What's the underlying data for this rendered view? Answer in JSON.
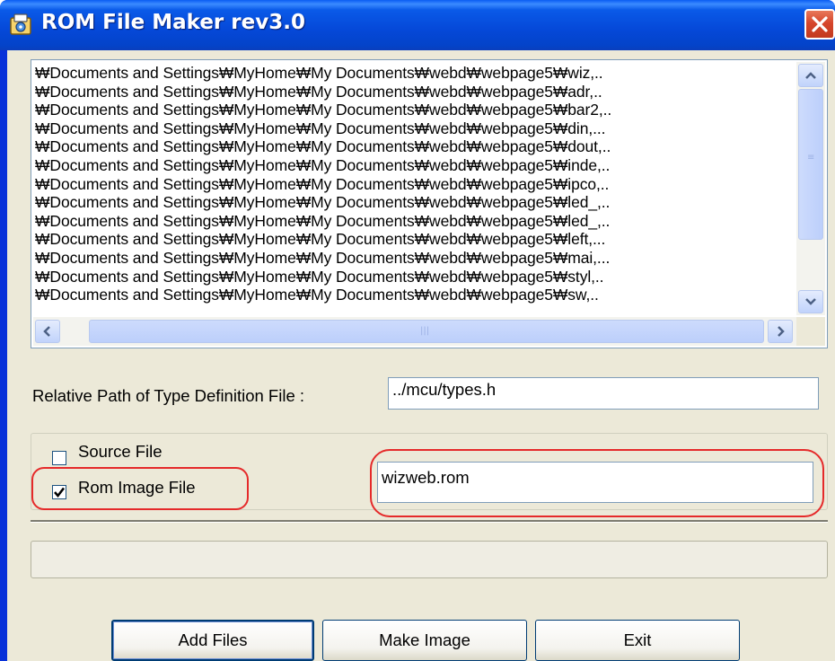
{
  "window": {
    "title": "ROM File Maker rev3.0"
  },
  "file_list": {
    "items": [
      "₩Documents and Settings₩MyHome₩My Documents₩webd₩webpage5₩wiz,..",
      "₩Documents and Settings₩MyHome₩My Documents₩webd₩webpage5₩adr,..",
      "₩Documents and Settings₩MyHome₩My Documents₩webd₩webpage5₩bar2,..",
      "₩Documents and Settings₩MyHome₩My Documents₩webd₩webpage5₩din,...",
      "₩Documents and Settings₩MyHome₩My Documents₩webd₩webpage5₩dout,..",
      "₩Documents and Settings₩MyHome₩My Documents₩webd₩webpage5₩inde,..",
      "₩Documents and Settings₩MyHome₩My Documents₩webd₩webpage5₩ipco,..",
      "₩Documents and Settings₩MyHome₩My Documents₩webd₩webpage5₩led_,..",
      "₩Documents and Settings₩MyHome₩My Documents₩webd₩webpage5₩led_,..",
      "₩Documents and Settings₩MyHome₩My Documents₩webd₩webpage5₩left,...",
      "₩Documents and Settings₩MyHome₩My Documents₩webd₩webpage5₩mai,...",
      "₩Documents and Settings₩MyHome₩My Documents₩webd₩webpage5₩styl,..",
      "₩Documents and Settings₩MyHome₩My Documents₩webd₩webpage5₩sw,.."
    ]
  },
  "type_def": {
    "label": "Relative Path of Type Definition File :",
    "value": "../mcu/types.h"
  },
  "output": {
    "source_label": "Source File",
    "source_checked": false,
    "rom_label": "Rom Image File",
    "rom_checked": true,
    "rom_filename": "wizweb.rom"
  },
  "buttons": {
    "add_files": "Add Files",
    "make_image": "Make Image",
    "exit": "Exit"
  },
  "icons": {
    "title": "app-icon",
    "close": "close-icon",
    "scroll_up": "arrow-up-icon",
    "scroll_down": "arrow-down-icon",
    "scroll_left": "arrow-left-icon",
    "scroll_right": "arrow-right-icon",
    "check": "checkmark-icon"
  },
  "colors": {
    "title_bar": "#0548d8",
    "dialog_bg": "#ece9d8",
    "close_button": "#d6462c",
    "highlight": "#e52a2a"
  }
}
